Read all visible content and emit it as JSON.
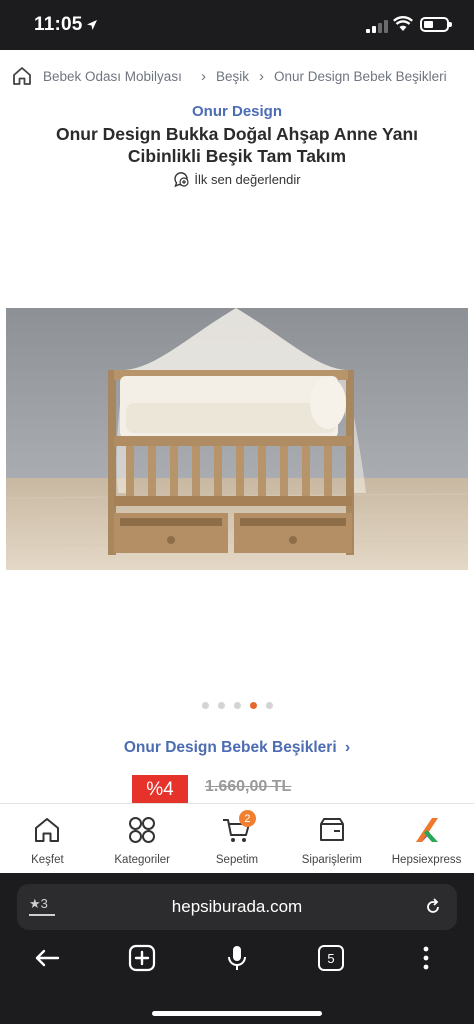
{
  "status": {
    "time": "11:05"
  },
  "breadcrumb": {
    "items": [
      "Bebek Odası Mobilyası",
      "Beşik",
      "Onur Design Bebek Beşikleri"
    ]
  },
  "product": {
    "brand": "Onur Design",
    "title": "Onur Design Bukka Doğal Ahşap Anne Yanı Cibinlikli Beşik Tam Takım",
    "review_prompt": "İlk sen değerlendir",
    "gallery": {
      "count": 5,
      "active_index": 3
    },
    "category_link": "Onur Design Bebek Beşikleri",
    "discount": "%4",
    "old_price": "1.660,00 TL"
  },
  "app_nav": {
    "items": [
      {
        "label": "Keşfet",
        "icon": "home-icon"
      },
      {
        "label": "Kategoriler",
        "icon": "categories-icon"
      },
      {
        "label": "Sepetim",
        "icon": "cart-icon",
        "badge": "2"
      },
      {
        "label": "Siparişlerim",
        "icon": "orders-icon"
      },
      {
        "label": "Hepsiexpress",
        "icon": "hepsiexpress-icon"
      }
    ]
  },
  "browser": {
    "url": "hepsiburada.com",
    "reader_count": "3",
    "tab_count": "5"
  },
  "colors": {
    "brand_blue": "#4c6cb3",
    "accent_orange": "#f08030",
    "discount_red": "#e5322a"
  }
}
